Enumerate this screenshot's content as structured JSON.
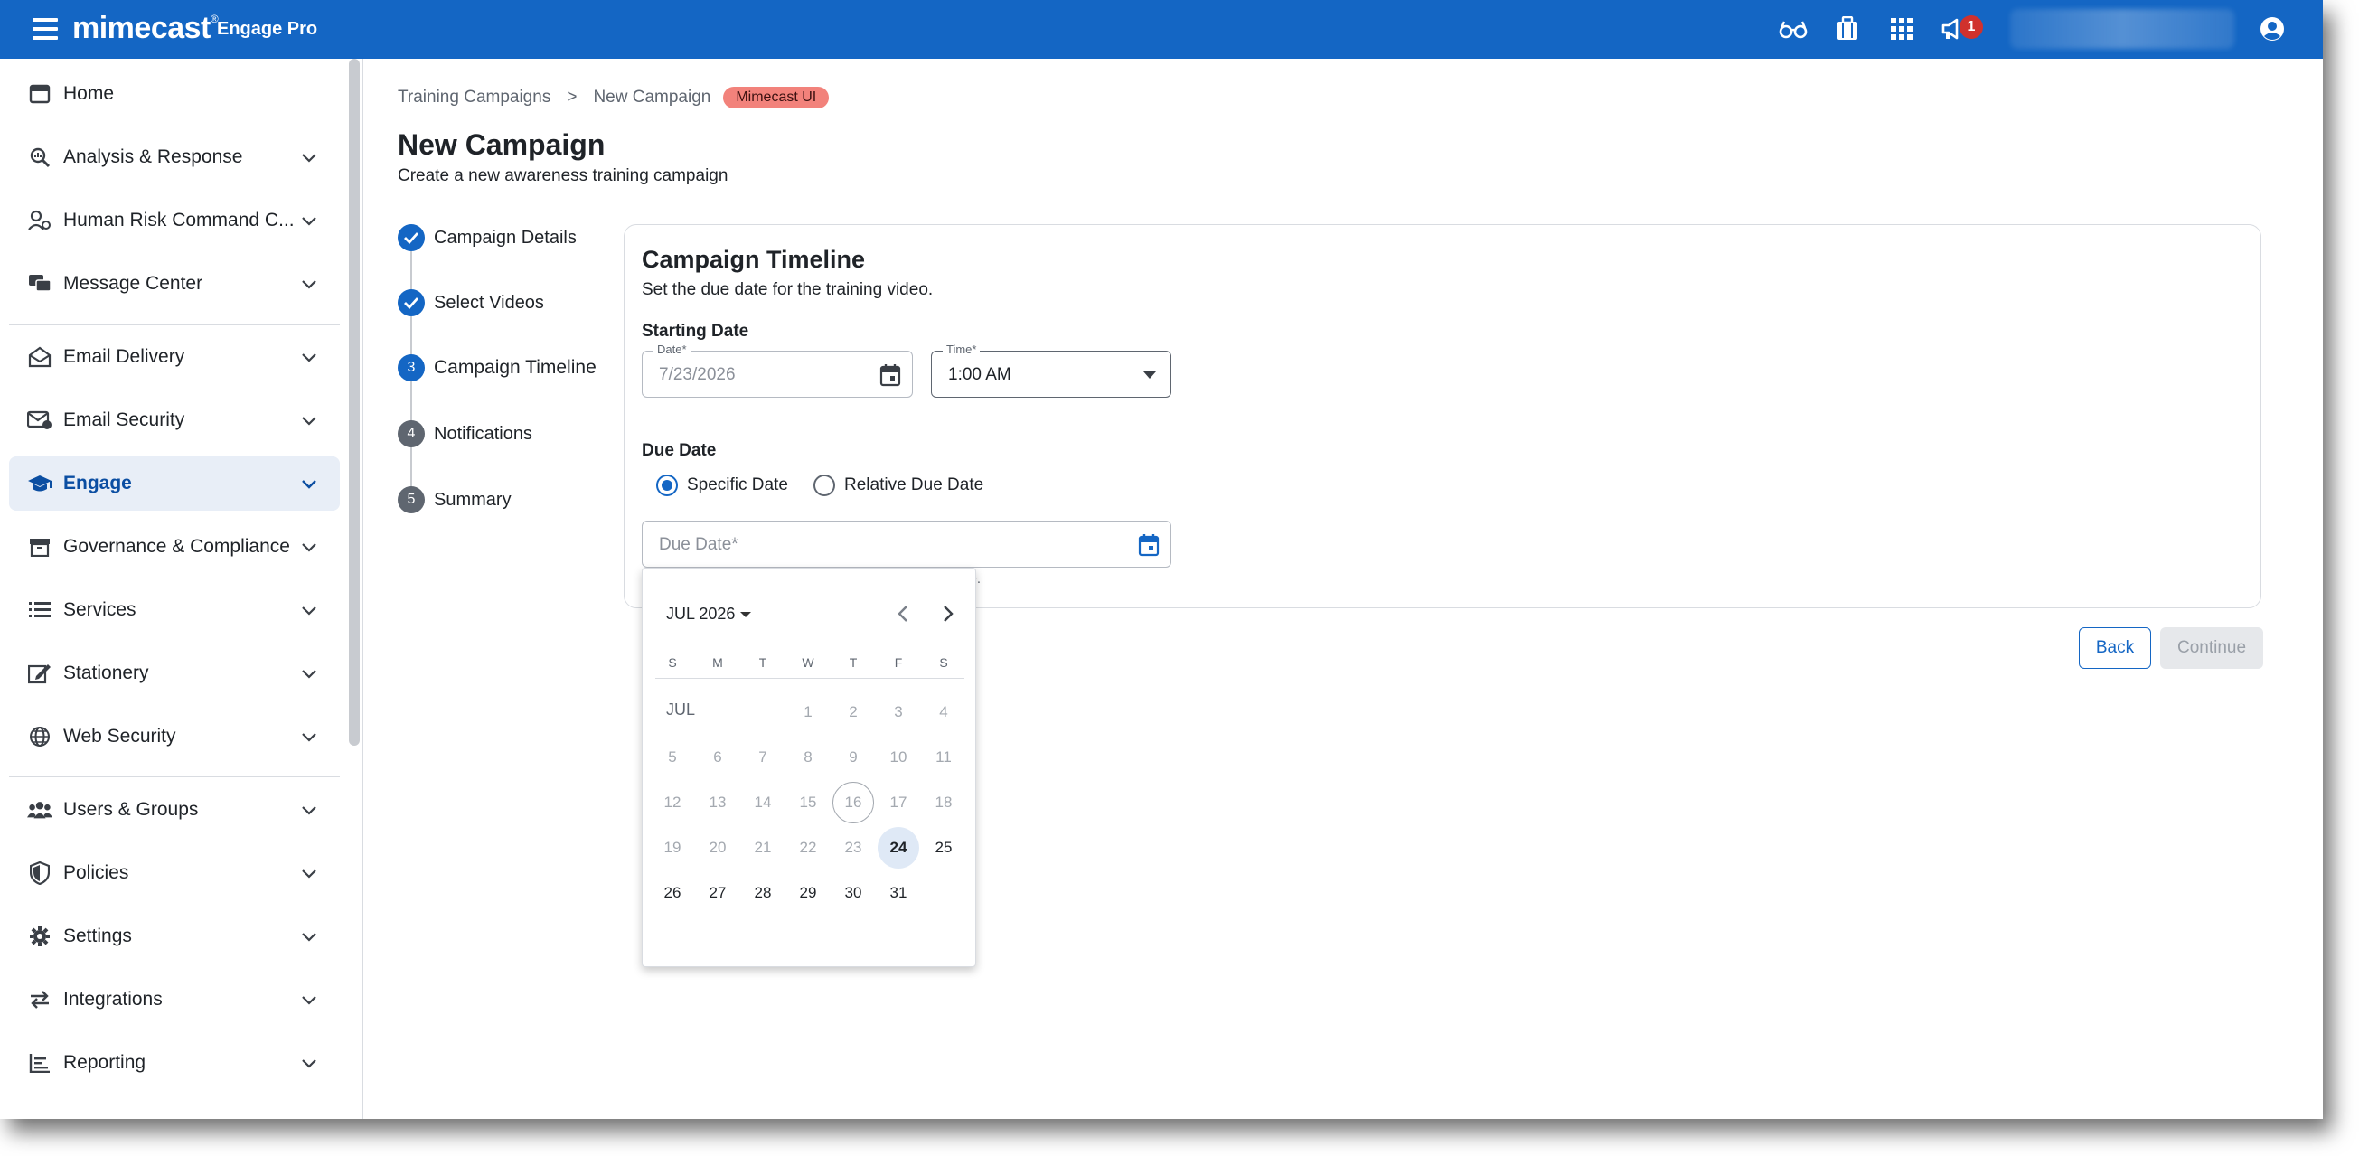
{
  "topbar": {
    "logo": "mimecast",
    "logo_mark": "®",
    "product": "Engage Pro",
    "icons": [
      "reading-glasses-icon",
      "briefcase-icon",
      "apps-grid-icon",
      "megaphone-icon",
      "account-icon"
    ],
    "notification_count": "1",
    "color": "#1466c4"
  },
  "sidebar": {
    "items": [
      {
        "label": "Home",
        "icon": "home-icon"
      },
      {
        "label": "Analysis & Response",
        "icon": "analysis-icon"
      },
      {
        "label": "Human Risk Command C...",
        "icon": "human-risk-icon"
      },
      {
        "label": "Message Center",
        "icon": "message-center-icon"
      },
      {
        "label": "Email Delivery",
        "icon": "email-delivery-icon"
      },
      {
        "label": "Email Security",
        "icon": "email-security-icon"
      },
      {
        "label": "Engage",
        "icon": "graduation-cap-icon",
        "active": true
      },
      {
        "label": "Governance & Compliance",
        "icon": "archive-icon"
      },
      {
        "label": "Services",
        "icon": "list-icon"
      },
      {
        "label": "Stationery",
        "icon": "stationery-icon"
      },
      {
        "label": "Web Security",
        "icon": "globe-icon"
      },
      {
        "label": "Users & Groups",
        "icon": "users-icon"
      },
      {
        "label": "Policies",
        "icon": "shield-icon"
      },
      {
        "label": "Settings",
        "icon": "gear-icon"
      },
      {
        "label": "Integrations",
        "icon": "integrations-icon"
      },
      {
        "label": "Reporting",
        "icon": "reporting-icon"
      }
    ]
  },
  "breadcrumb": {
    "items": [
      "Training Campaigns",
      "New Campaign"
    ],
    "separator": ">",
    "env_badge": "Mimecast UI"
  },
  "page": {
    "title": "New Campaign",
    "subtitle": "Create a new awareness training campaign"
  },
  "stepper": {
    "steps": [
      {
        "label": "Campaign Details",
        "state": "done",
        "number": "1"
      },
      {
        "label": "Select Videos",
        "state": "done",
        "number": "2"
      },
      {
        "label": "Campaign Timeline",
        "state": "current",
        "number": "3"
      },
      {
        "label": "Notifications",
        "state": "pending",
        "number": "4"
      },
      {
        "label": "Summary",
        "state": "pending",
        "number": "5"
      }
    ]
  },
  "timeline": {
    "title": "Campaign Timeline",
    "subtitle": "Set the due date for the training video.",
    "starting_date_label": "Starting Date",
    "date_field_label": "Date*",
    "date_value": "7/23/2026",
    "time_field_label": "Time*",
    "time_value": "1:00 AM",
    "due_date_label": "Due Date",
    "radio_specific": "Specific Date",
    "radio_relative": "Relative Due Date",
    "selected_radio": "specific",
    "due_date_placeholder": "Due Date*",
    "hint_fragment": "ate."
  },
  "buttons": {
    "back": "Back",
    "continue": "Continue"
  },
  "datepicker": {
    "month_year": "JUL 2026",
    "month_short": "JUL",
    "weekdays": [
      "S",
      "M",
      "T",
      "W",
      "T",
      "F",
      "S"
    ],
    "first_weekday_index": 3,
    "days_in_month": 31,
    "today": 16,
    "selected": 24,
    "first_enabled": 24
  }
}
